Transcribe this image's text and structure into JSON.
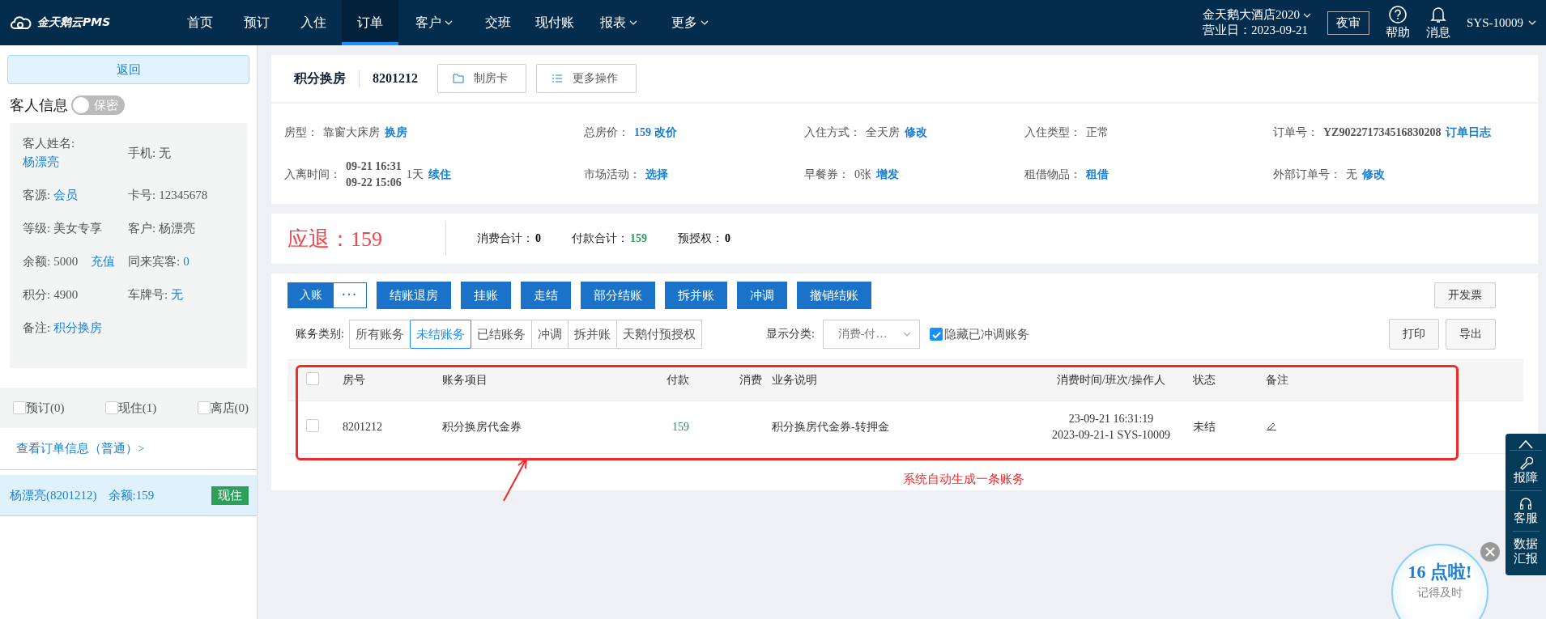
{
  "header": {
    "brand": "金天鹅云PMS",
    "nav": [
      {
        "label": "首页",
        "selected": false,
        "dropdown": false
      },
      {
        "label": "预订",
        "selected": false,
        "dropdown": false
      },
      {
        "label": "入住",
        "selected": false,
        "dropdown": false
      },
      {
        "label": "订单",
        "selected": true,
        "dropdown": false
      },
      {
        "label": "客户",
        "selected": false,
        "dropdown": true
      },
      {
        "label": "交班",
        "selected": false,
        "dropdown": false
      },
      {
        "label": "现付账",
        "selected": false,
        "dropdown": false
      },
      {
        "label": "报表",
        "selected": false,
        "dropdown": true
      },
      {
        "label": "更多",
        "selected": false,
        "dropdown": true
      }
    ],
    "hotel": "金天鹅大酒店2020",
    "business_day": "营业日：2023-09-21",
    "night_audit": "夜审",
    "help": "帮助",
    "messages": "消息",
    "user": "SYS-10009"
  },
  "sidebar": {
    "back": "返回",
    "guest_title": "客人信息",
    "privacy_toggle": {
      "label": "保密",
      "on": false
    },
    "fields": [
      {
        "label": "客人姓名:",
        "link": "杨漂亮",
        "kind": "stacked"
      },
      {
        "label": "手机:",
        "value": "无",
        "kind": "inline"
      },
      {
        "label": "客源:",
        "link": "会员",
        "kind": "inline"
      },
      {
        "label": "卡号:",
        "value": "12345678",
        "kind": "inline"
      },
      {
        "label": "等级:",
        "value": "美女专享",
        "kind": "inline"
      },
      {
        "label": "客户:",
        "value": "杨漂亮",
        "kind": "inline"
      },
      {
        "label": "余额:",
        "value": "5000",
        "link": "充值",
        "kind": "inline"
      },
      {
        "label": "同来宾客:",
        "link": "0",
        "kind": "inline"
      },
      {
        "label": "积分:",
        "value": "4900",
        "kind": "inline"
      },
      {
        "label": "车牌号:",
        "link": "无",
        "kind": "inline"
      },
      {
        "label": "备注:",
        "link": "积分换房",
        "kind": "inline"
      }
    ],
    "filters": [
      {
        "label": "预订(0)",
        "checked": false
      },
      {
        "label": "现住(1)",
        "checked": false
      },
      {
        "label": "离店(0)",
        "checked": false
      }
    ],
    "order_link": "查看订单信息（普通）>",
    "guests": [
      {
        "name": "杨漂亮(8201212)",
        "balance": "余额:159",
        "status": "现住",
        "selected": true
      }
    ]
  },
  "order": {
    "title": "积分换房",
    "room": "8201212",
    "buttons": [
      {
        "label": "制房卡",
        "kind": "card"
      },
      {
        "label": "更多操作",
        "kind": "list"
      }
    ],
    "fields": [
      {
        "label": "房型：",
        "parts": [
          {
            "kind": "plain",
            "text": "靠窗大床房"
          },
          {
            "kind": "link",
            "text": "换房"
          }
        ]
      },
      {
        "label": "总房价：",
        "parts": [
          {
            "kind": "link",
            "text": "159 改价"
          }
        ]
      },
      {
        "label": "入住方式：",
        "parts": [
          {
            "kind": "plain",
            "text": "全天房"
          },
          {
            "kind": "link",
            "text": "修改"
          }
        ]
      },
      {
        "label": "入住类型：",
        "parts": [
          {
            "kind": "plain",
            "text": "正常"
          }
        ]
      },
      {
        "label": "订单号：",
        "parts": [
          {
            "kind": "bold",
            "text": "YZ902271734516830208"
          },
          {
            "kind": "link",
            "text": "订单日志"
          }
        ]
      },
      {
        "label": "入离时间：",
        "parts": [
          {
            "kind": "stack",
            "lines": [
              "09-21 16:31",
              "09-22 15:06"
            ]
          },
          {
            "kind": "plain",
            "text": "1天"
          },
          {
            "kind": "link",
            "text": "续住"
          }
        ]
      },
      {
        "label": "市场活动：",
        "parts": [
          {
            "kind": "link",
            "text": "选择"
          }
        ]
      },
      {
        "label": "早餐券：",
        "parts": [
          {
            "kind": "plain",
            "text": "0张"
          },
          {
            "kind": "link",
            "text": "增发"
          }
        ]
      },
      {
        "label": "租借物品：",
        "parts": [
          {
            "kind": "link",
            "text": "租借"
          }
        ]
      },
      {
        "label": "外部订单号：",
        "parts": [
          {
            "kind": "plain",
            "text": "无"
          },
          {
            "kind": "link",
            "text": "修改"
          }
        ]
      }
    ]
  },
  "summary": {
    "refund_label": "应退：",
    "refund": "159",
    "items": [
      {
        "label": "消费合计：",
        "value": "0",
        "color": "#000000"
      },
      {
        "label": "付款合计：",
        "value": "159",
        "color": "#2e9e5b"
      },
      {
        "label": "预授权：",
        "value": "0",
        "color": "#000000"
      }
    ]
  },
  "billing": {
    "post": "入账",
    "more": "···",
    "actions": [
      "结账退房",
      "挂账",
      "走结",
      "部分结账",
      "拆并账",
      "冲调",
      "撤销结账"
    ],
    "invoice": "开发票",
    "category_label": "账务类别:",
    "categories": [
      {
        "label": "所有账务",
        "selected": false
      },
      {
        "label": "未结账务",
        "selected": true
      },
      {
        "label": "已结账务",
        "selected": false
      },
      {
        "label": "冲调",
        "selected": false
      },
      {
        "label": "拆并账",
        "selected": false
      },
      {
        "label": "天鹅付预授权",
        "selected": false
      }
    ],
    "display_label": "显示分类:",
    "display_value": "消费-付…",
    "hide_adjusted": {
      "label": "隐藏已冲调账务",
      "checked": true
    },
    "print": "打印",
    "export": "导出",
    "table": {
      "header_checked": false,
      "columns": [
        "房号",
        "账务项目",
        "付款",
        "消费",
        "业务说明",
        "消费时间/班次/操作人",
        "状态",
        "备注"
      ],
      "rows": [
        {
          "checked": false,
          "room": "8201212",
          "item": "积分换房代金券",
          "payment": "159",
          "description": "积分换房代金券-转押金",
          "time_lines": [
            "23-09-21 16:31:19",
            "2023-09-21-1 SYS-10009"
          ],
          "status": "未结"
        }
      ]
    },
    "annotation": "系统自动生成一条账务"
  },
  "side_tools": {
    "items": [
      {
        "label": "报障",
        "kind": "wrench"
      },
      {
        "label": "客服",
        "kind": "headset"
      },
      {
        "label": "数据汇报",
        "kind": "text"
      }
    ]
  },
  "reminder": {
    "title": "16 点啦!",
    "text": "记得及时"
  }
}
